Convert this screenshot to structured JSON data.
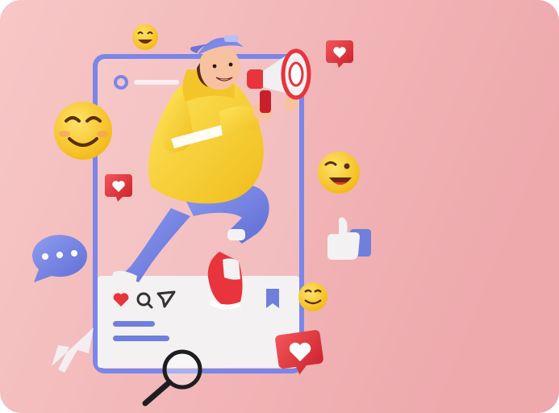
{
  "image": {
    "background_colors": {
      "left": "#f6c4c4",
      "right": "#eeaaae"
    }
  },
  "phone_frame": {
    "frame_color": "#7a86e8",
    "card_color": "#f4f1f3",
    "icons": [
      "heart-icon",
      "comment-icon",
      "send-icon",
      "bookmark-icon"
    ],
    "caption_line_color": "#6f7fdc"
  },
  "character": {
    "hoodie_color": "#f6d23c",
    "pants_color": "#7d89e6",
    "cap_color": "#7d89e6",
    "megaphone_color": "#e8343c"
  },
  "floating_items": [
    "grinning-emoji",
    "smiling-emoji",
    "winking-emoji",
    "happy-emoji",
    "heart-notification",
    "heart-notification",
    "heart-notification",
    "speech-bubble-icon",
    "thumbs-up-icon",
    "cursor-arrow-icon",
    "magnifier-icon"
  ],
  "colors": {
    "emoji_yellow": "#f9cf2c",
    "notification_red": "#e8343c",
    "accent_blue": "#7a86e8"
  }
}
